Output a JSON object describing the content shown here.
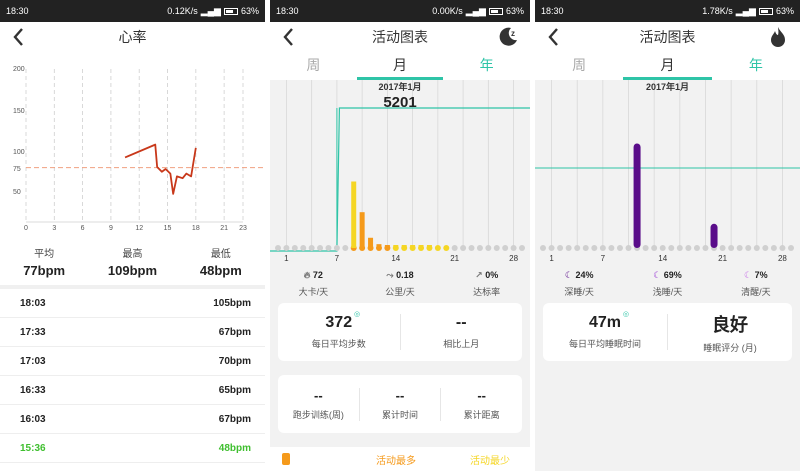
{
  "status": [
    {
      "time": "18:30",
      "speed": "0.12K/s",
      "battery": "63%"
    },
    {
      "time": "18:30",
      "speed": "0.00K/s",
      "battery": "63%"
    },
    {
      "time": "18:30",
      "speed": "1.78K/s",
      "battery": "63%"
    }
  ],
  "heart": {
    "title": "心率",
    "y_ticks": [
      "200",
      "150",
      "100",
      "75",
      "50"
    ],
    "x_ticks": [
      "0",
      "3",
      "6",
      "9",
      "12",
      "15",
      "18",
      "21",
      "23"
    ],
    "avg_label": "平均",
    "avg_value": "77bpm",
    "max_label": "最高",
    "max_value": "109bpm",
    "min_label": "最低",
    "min_value": "48bpm",
    "rows": [
      {
        "time": "18:03",
        "value": "105bpm"
      },
      {
        "time": "17:33",
        "value": "67bpm"
      },
      {
        "time": "17:03",
        "value": "70bpm"
      },
      {
        "time": "16:33",
        "value": "65bpm"
      },
      {
        "time": "16:03",
        "value": "67bpm"
      },
      {
        "time": "15:36",
        "value": "48bpm",
        "highlight": true
      }
    ],
    "colors": {
      "line": "#c8381a",
      "avg": "#f0a080",
      "highlight": "#3fbf2f"
    }
  },
  "activity": {
    "title": "活动图表",
    "tabs": [
      "周",
      "月",
      "年"
    ],
    "month": "2017年1月",
    "steps_value": "5201",
    "x_ticks": [
      "1",
      "7",
      "14",
      "21",
      "28"
    ],
    "stats": [
      {
        "value": "72",
        "label": "大卡/天"
      },
      {
        "value": "0.18",
        "label": "公里/天"
      },
      {
        "value": "0%",
        "label": "达标率"
      }
    ],
    "card1": {
      "value": "372",
      "label": "每日平均步数",
      "value2": "--",
      "label2": "相比上月"
    },
    "card2": [
      {
        "value": "--",
        "label": "跑步训练(周)"
      },
      {
        "value": "--",
        "label": "累计时间"
      },
      {
        "value": "--",
        "label": "累计距离"
      }
    ],
    "legend": {
      "most": "活动最多",
      "least": "活动最少"
    },
    "colors": {
      "accent": "#2ec4a7",
      "bar": "#f5d624",
      "orange": "#f59a1b"
    }
  },
  "sleep": {
    "title": "活动图表",
    "tabs": [
      "周",
      "月",
      "年"
    ],
    "month": "2017年1月",
    "x_ticks": [
      "1",
      "7",
      "14",
      "21",
      "28"
    ],
    "stats": [
      {
        "value": "24%",
        "label": "深睡/天"
      },
      {
        "value": "69%",
        "label": "浅睡/天"
      },
      {
        "value": "7%",
        "label": "清醒/天"
      }
    ],
    "card": {
      "value": "47m",
      "label": "每日平均睡眠时间",
      "value2": "良好",
      "label2": "睡眠评分 (月)"
    },
    "colors": {
      "bar": "#5a0d8a",
      "accent": "#2ec4a7"
    }
  },
  "chart_data": [
    {
      "type": "line",
      "title": "心率",
      "x_ticks": [
        "0",
        "3",
        "6",
        "9",
        "12",
        "15",
        "18",
        "21",
        "23"
      ],
      "y_ticks": [
        "50",
        "75",
        "100",
        "150",
        "200"
      ],
      "series": [
        {
          "x": [
            10.5,
            13.7,
            13.9,
            14.4,
            14.8,
            15.3,
            15.6,
            16.0,
            16.6,
            17.0,
            17.5,
            18.0
          ],
          "values": [
            92,
            109,
            78,
            72,
            75,
            70,
            48,
            67,
            65,
            70,
            67,
            105
          ]
        }
      ],
      "avg": 77
    },
    {
      "type": "bar",
      "x_ticks": [
        "1",
        "7",
        "14",
        "21",
        "28"
      ],
      "days": [
        9,
        10,
        11,
        12,
        13,
        14,
        15,
        16,
        17,
        18,
        19,
        20,
        21
      ],
      "values": [
        2600,
        1400,
        400,
        150,
        80,
        60,
        60,
        50,
        40,
        20,
        0,
        0,
        0
      ]
    },
    {
      "type": "bar",
      "x_ticks": [
        "1",
        "7",
        "14",
        "21",
        "28"
      ],
      "days": [
        11,
        20
      ],
      "values": [
        9.5,
        2.2
      ]
    }
  ]
}
